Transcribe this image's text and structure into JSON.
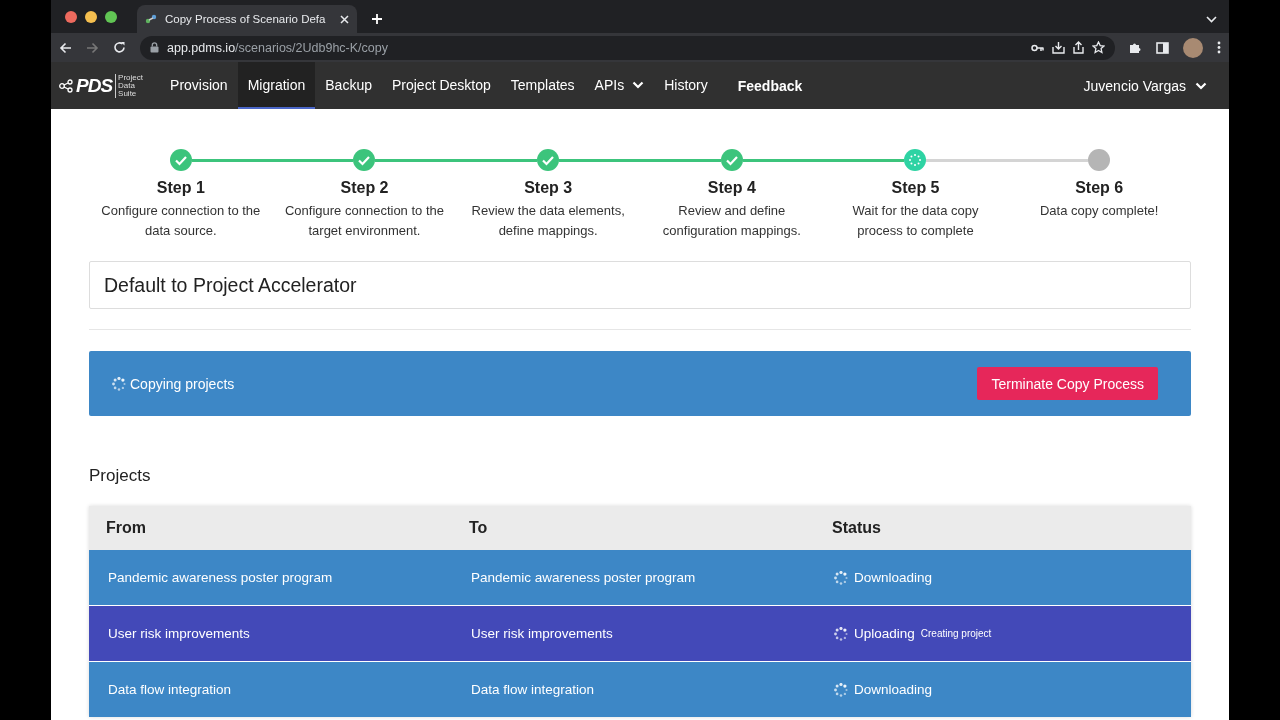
{
  "browser": {
    "tab_title": "Copy Process of Scenario Defa",
    "url_host": "app.pdms.io",
    "url_path": "/scenarios/2Udb9hc-K/copy"
  },
  "navbar": {
    "logo_text": "PDS",
    "logo_subtitle": "Project Data Suite",
    "items": [
      {
        "label": "Provision",
        "selected": false,
        "dropdown": false
      },
      {
        "label": "Migration",
        "selected": true,
        "dropdown": false
      },
      {
        "label": "Backup",
        "selected": false,
        "dropdown": false
      },
      {
        "label": "Project Desktop",
        "selected": false,
        "dropdown": false
      },
      {
        "label": "Templates",
        "selected": false,
        "dropdown": false
      },
      {
        "label": "APIs",
        "selected": false,
        "dropdown": true
      },
      {
        "label": "History",
        "selected": false,
        "dropdown": false
      }
    ],
    "feedback": "Feedback",
    "user": "Juvencio Vargas"
  },
  "steps": [
    {
      "title": "Step 1",
      "description": "Configure connection to the data source.",
      "kind": "done"
    },
    {
      "title": "Step 2",
      "description": "Configure connection to the target environment.",
      "kind": "done"
    },
    {
      "title": "Step 3",
      "description": "Review the data elements, define mappings.",
      "kind": "done"
    },
    {
      "title": "Step 4",
      "description": "Review and define configuration mappings.",
      "kind": "done"
    },
    {
      "title": "Step 5",
      "description": "Wait for the data copy process to complete",
      "kind": "active"
    },
    {
      "title": "Step 6",
      "description": "Data copy complete!",
      "kind": "pending"
    }
  ],
  "scenario_name": "Default to Project Accelerator",
  "progress_banner": {
    "message": "Copying projects",
    "button": "Terminate Copy Process"
  },
  "projects": {
    "heading": "Projects",
    "columns": [
      "From",
      "To",
      "Status"
    ],
    "rows": [
      {
        "from": "Pandemic awareness poster program",
        "to": "Pandemic awareness poster program",
        "status": "Downloading",
        "color": "#3d87c6"
      },
      {
        "from": "User risk improvements",
        "to": "User risk improvements",
        "status": "Uploading",
        "detail": "Creating project",
        "color": "#4349b8"
      },
      {
        "from": "Data flow integration",
        "to": "Data flow integration",
        "status": "Downloading",
        "color": "#3d87c6"
      }
    ]
  }
}
